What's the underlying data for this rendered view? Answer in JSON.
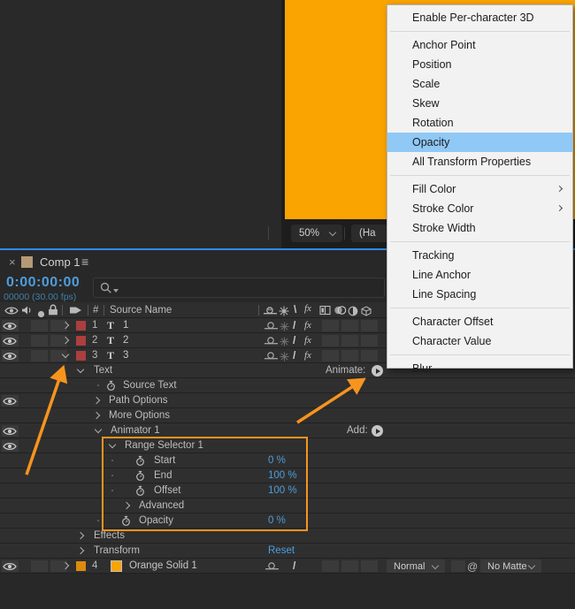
{
  "viewer": {
    "comp_color": "#f9a400",
    "zoom_value": "50%",
    "resolution_partial": "(Ha"
  },
  "timeline": {
    "tab": {
      "close": "×",
      "title": "Comp 1",
      "menu_icon": "≡"
    },
    "timecode": "0:00:00:00",
    "frames_info": "00000 (30.00 fps)",
    "columns": {
      "number": "#",
      "source_name": "Source Name"
    },
    "icons": {
      "quality_row": "/",
      "quality_header": "\\",
      "fx": "fx",
      "track_matte_pickwhip": "@"
    },
    "rows": {
      "layer1": {
        "num": "1",
        "type_icon": "T",
        "name": "1"
      },
      "layer2": {
        "num": "2",
        "type_icon": "T",
        "name": "2"
      },
      "layer3": {
        "num": "3",
        "type_icon": "T",
        "name": "3"
      },
      "text_group": {
        "label": "Text",
        "animate_label": "Animate:"
      },
      "source_text": {
        "label": "Source Text"
      },
      "path_options": {
        "label": "Path Options"
      },
      "more_options": {
        "label": "More Options"
      },
      "animator1": {
        "label": "Animator 1",
        "add_label": "Add:"
      },
      "range_selector": {
        "label": "Range Selector 1"
      },
      "start": {
        "label": "Start",
        "value": "0 %"
      },
      "end": {
        "label": "End",
        "value": "100 %"
      },
      "offset": {
        "label": "Offset",
        "value": "100 %"
      },
      "advanced": {
        "label": "Advanced"
      },
      "opacity": {
        "label": "Opacity",
        "value": "0 %"
      },
      "effects": {
        "label": "Effects"
      },
      "transform": {
        "label": "Transform",
        "reset_label": "Reset"
      },
      "layer4": {
        "num": "4",
        "name": "Orange Solid 1",
        "blend_mode": "Normal",
        "track_matte": "No Matte"
      }
    },
    "value_color": "#4c9edc",
    "label_red": "#ad3e3e",
    "label_orange": "#de8a0f"
  },
  "menu": {
    "items": [
      "Enable Per-character 3D",
      "Anchor Point",
      "Position",
      "Scale",
      "Skew",
      "Rotation",
      "Opacity",
      "All Transform Properties",
      "Fill Color",
      "Stroke Color",
      "Stroke Width",
      "Tracking",
      "Line Anchor",
      "Line Spacing",
      "Character Offset",
      "Character Value",
      "Blur"
    ],
    "highlighted_item": "Opacity",
    "highlight_color": "#90c8f6"
  },
  "annotations": {
    "color": "#f7941e"
  }
}
